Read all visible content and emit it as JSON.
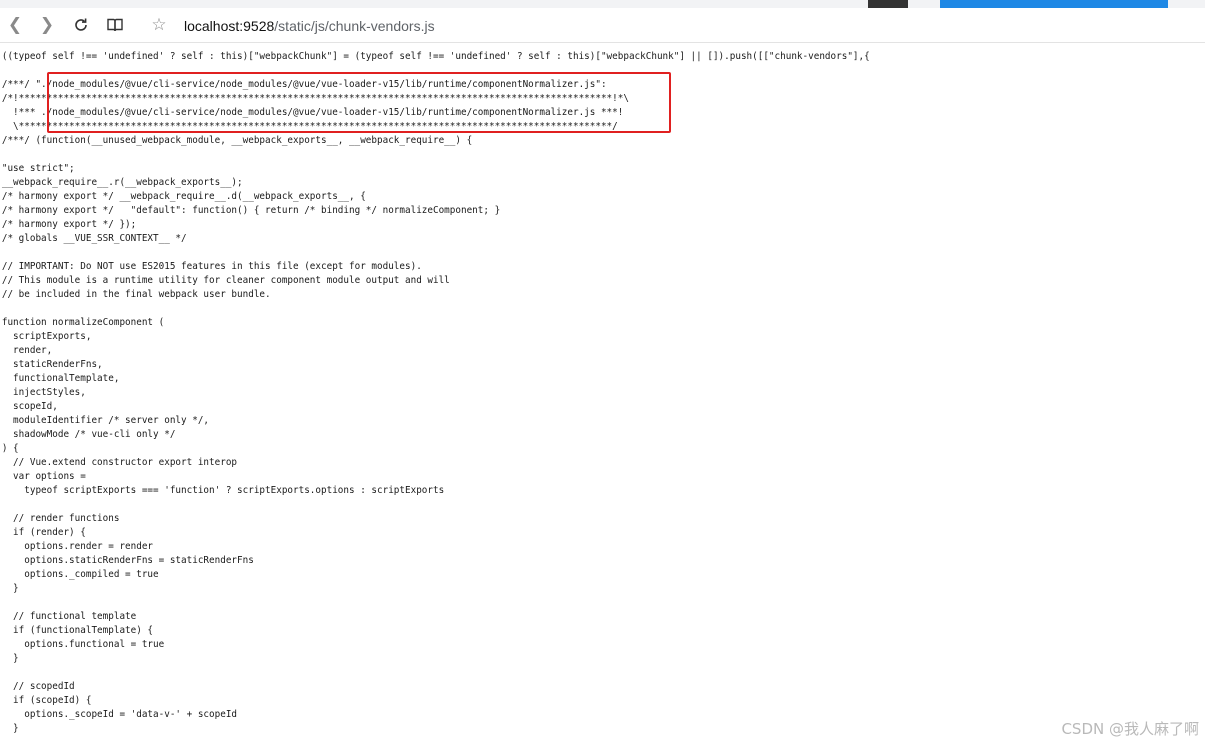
{
  "browser": {
    "colors": {
      "tab_accent": "#1e88e5",
      "toolbar_bg": "#ffffff",
      "highlight_border": "#e02020"
    },
    "icons": {
      "back": "chevron-left-icon",
      "forward": "chevron-right-icon",
      "reload": "reload-icon",
      "reader": "reader-view-icon",
      "favorite": "star-icon"
    },
    "address_bar": {
      "host": "localhost:9528",
      "path": "/static/js/chunk-vendors.js"
    }
  },
  "source": {
    "lines": [
      "((typeof self !== 'undefined' ? self : this)[\"webpackChunk\"] = (typeof self !== 'undefined' ? self : this)[\"webpackChunk\"] || []).push([[\"chunk-vendors\"],{",
      "",
      "/***/ \"./node_modules/@vue/cli-service/node_modules/@vue/vue-loader-v15/lib/runtime/componentNormalizer.js\":",
      "/*!**********************************************************************************************************!*\\",
      "  !*** ./node_modules/@vue/cli-service/node_modules/@vue/vue-loader-v15/lib/runtime/componentNormalizer.js ***!",
      "  \\**********************************************************************************************************/",
      "/***/ (function(__unused_webpack_module, __webpack_exports__, __webpack_require__) {",
      "",
      "\"use strict\";",
      "__webpack_require__.r(__webpack_exports__);",
      "/* harmony export */ __webpack_require__.d(__webpack_exports__, {",
      "/* harmony export */   \"default\": function() { return /* binding */ normalizeComponent; }",
      "/* harmony export */ });",
      "/* globals __VUE_SSR_CONTEXT__ */",
      "",
      "// IMPORTANT: Do NOT use ES2015 features in this file (except for modules).",
      "// This module is a runtime utility for cleaner component module output and will",
      "// be included in the final webpack user bundle.",
      "",
      "function normalizeComponent (",
      "  scriptExports,",
      "  render,",
      "  staticRenderFns,",
      "  functionalTemplate,",
      "  injectStyles,",
      "  scopeId,",
      "  moduleIdentifier /* server only */,",
      "  shadowMode /* vue-cli only */",
      ") {",
      "  // Vue.extend constructor export interop",
      "  var options =",
      "    typeof scriptExports === 'function' ? scriptExports.options : scriptExports",
      "",
      "  // render functions",
      "  if (render) {",
      "    options.render = render",
      "    options.staticRenderFns = staticRenderFns",
      "    options._compiled = true",
      "  }",
      "",
      "  // functional template",
      "  if (functionalTemplate) {",
      "    options.functional = true",
      "  }",
      "",
      "  // scopedId",
      "  if (scopeId) {",
      "    options._scopeId = 'data-v-' + scopeId",
      "  }"
    ]
  },
  "watermark": "CSDN @我人麻了啊"
}
